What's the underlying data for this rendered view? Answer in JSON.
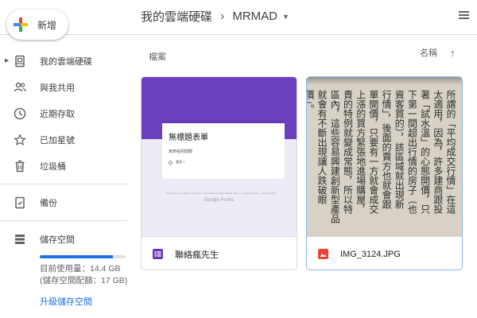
{
  "header": {
    "breadcrumb_root": "我的雲端硬碟",
    "breadcrumb_sep": "›",
    "breadcrumb_current": "MRMAD",
    "caret": "▼"
  },
  "new_button": {
    "label": "新增"
  },
  "sidebar": {
    "items": [
      {
        "label": "我的雲端硬碟",
        "icon": "drive-icon"
      },
      {
        "label": "與我共用",
        "icon": "people-icon"
      },
      {
        "label": "近期存取",
        "icon": "clock-icon"
      },
      {
        "label": "已加星號",
        "icon": "star-icon"
      },
      {
        "label": "垃圾桶",
        "icon": "trash-icon"
      }
    ],
    "backup": {
      "label": "備份",
      "icon": "backup-icon"
    },
    "storage": {
      "label": "儲存空間",
      "icon": "storage-icon",
      "used_fraction": 0.85,
      "usage_text": "目前使用量：14.4 GB (儲存空間配額：17 GB)",
      "upgrade_label": "升級儲存空間"
    }
  },
  "main": {
    "section_label": "檔案",
    "sort_label": "名稱",
    "sort_arrow": "↑",
    "files": [
      {
        "name": "聯絡瘋先生",
        "type": "google-form",
        "thumb": {
          "title": "無標題表單",
          "question": "未命名的問題",
          "option": "選項 1",
          "disclaimer": "This content is neither created nor endorsed by Google. Report Abuse - Terms of Service - Privacy Policy",
          "brand": "Google Forms"
        }
      },
      {
        "name": "IMG_3124.JPG",
        "type": "image",
        "selected": true,
        "thumb": {
          "columns": [
            "所謂的「平均成交行情」在這",
            "太適用，因為，許多建商跟投",
            "著「試水溫」的心態開價，只",
            "下第一間超出行情的房子（也",
            "資客買的），該區域就出現新",
            "行情」，後面的賣方也就會跟",
            "單開價，只要有一方就會成交",
            "上漲的買方緊張地進場購屋，",
            "貴的特例就變成常態，所以特",
            "區內，這些容易興建創新型產品",
            "就會有不斷出現讓人跌破眼",
            "價」。"
          ]
        }
      }
    ]
  },
  "colors": {
    "accent": "#1a73e8",
    "form_purple": "#673ab7",
    "image_red": "#ea4335"
  }
}
